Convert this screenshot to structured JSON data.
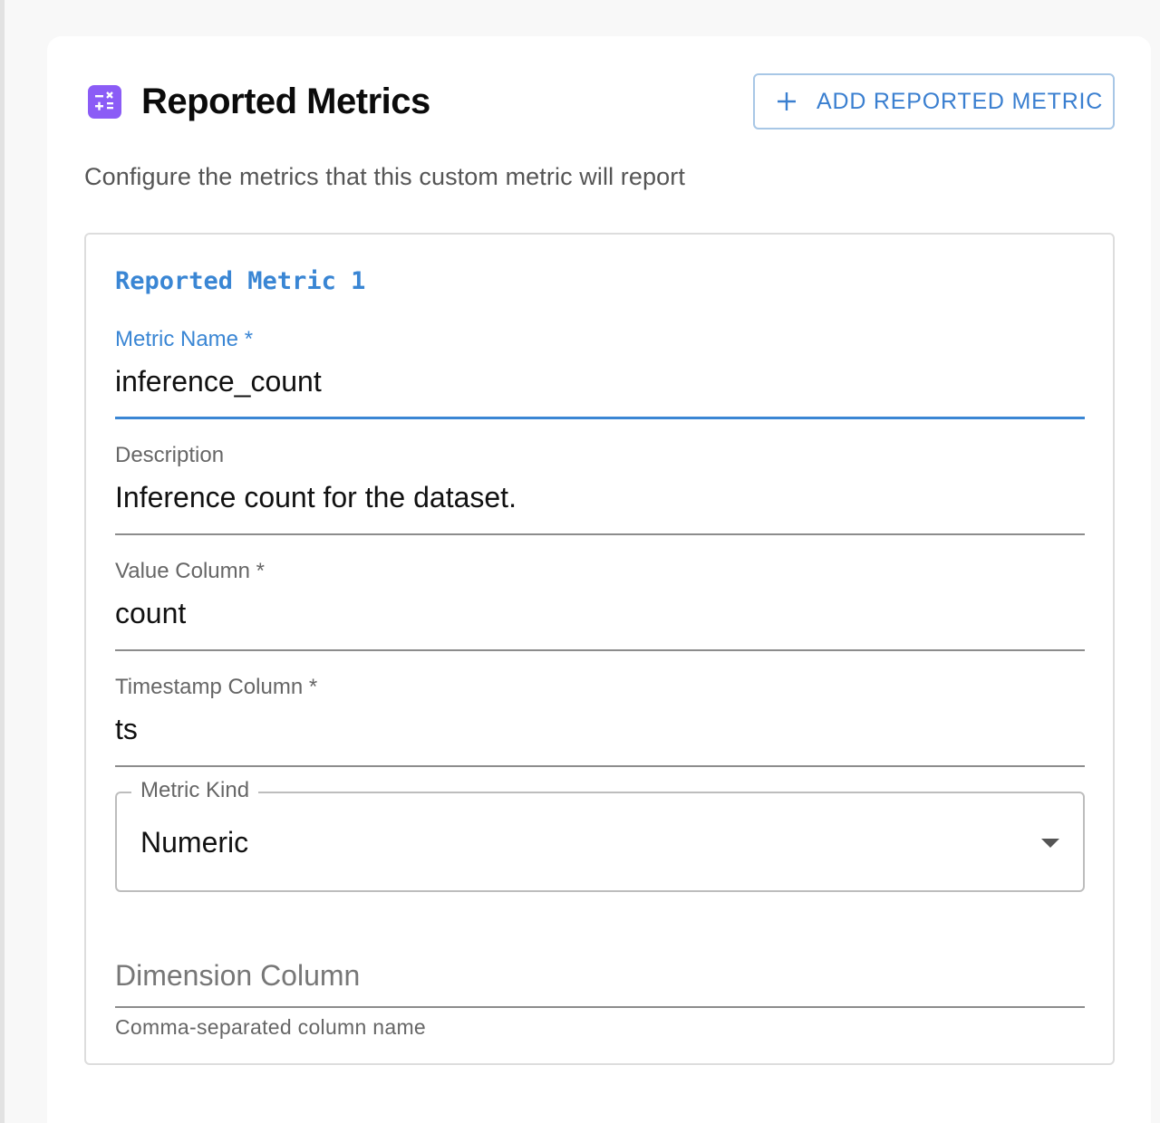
{
  "page": {
    "title": "Reported Metrics",
    "subtitle": "Configure the metrics that this custom metric will report",
    "add_button_label": "ADD REPORTED METRIC",
    "accent_color": "#3a86d4",
    "icon_color": "#8b5cf6"
  },
  "metric": {
    "heading": "Reported Metric 1",
    "fields": {
      "metric_name": {
        "label": "Metric Name",
        "required": "*",
        "value": "inference_count"
      },
      "description": {
        "label": "Description",
        "value": "Inference count for the dataset."
      },
      "value_column": {
        "label": "Value Column",
        "required": "*",
        "value": "count"
      },
      "timestamp_column": {
        "label": "Timestamp Column",
        "required": "*",
        "value": "ts"
      },
      "metric_kind": {
        "label": "Metric Kind",
        "value": "Numeric"
      },
      "dimension_column": {
        "placeholder": "Dimension Column",
        "helper": "Comma-separated column name"
      }
    }
  }
}
